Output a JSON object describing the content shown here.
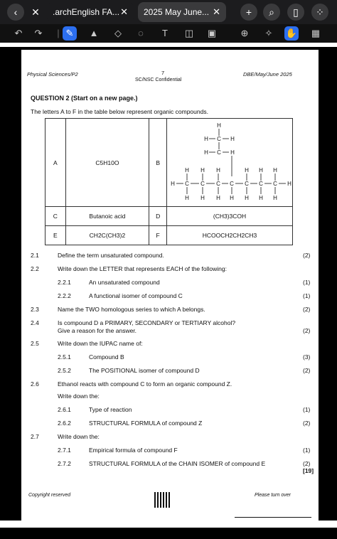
{
  "tabs": [
    {
      "label": ".archEnglish FA..."
    },
    {
      "label": "2025 May June..."
    }
  ],
  "toolbar_icons": [
    "undo-icon",
    "redo-icon",
    "pen-icon",
    "highlighter-icon",
    "eraser-icon",
    "lasso-icon",
    "text-icon",
    "shapes-icon",
    "image-icon",
    "zoom-icon",
    "laser-icon",
    "hand-icon",
    "grid-icon"
  ],
  "header": {
    "left": "Physical Sciences/P2",
    "page_num": "7",
    "center": "SC/NSC Confidential",
    "right": "DBE/May/June 2025"
  },
  "question": {
    "title": "QUESTION 2 (Start on a new page.)",
    "intro": "The letters A to F in the table below represent organic compounds."
  },
  "table": {
    "a_letter": "A",
    "a_formula": "C5H10O",
    "b_letter": "B",
    "c_letter": "C",
    "c_name": "Butanoic acid",
    "d_letter": "D",
    "d_formula": "(CH3)3COH",
    "e_letter": "E",
    "e_formula": "CH2C(CH3)2",
    "f_letter": "F",
    "f_formula": "HCOOCH2CH2CH3"
  },
  "items": [
    {
      "num": "2.1",
      "text": "Define the term unsaturated compound.",
      "mark": "(2)"
    },
    {
      "num": "2.2",
      "text": "Write down the LETTER that represents EACH of the following:",
      "mark": ""
    },
    {
      "num": "2.2.1",
      "text": "An unsaturated compound",
      "mark": "(1)"
    },
    {
      "num": "2.2.2",
      "text": "A functional isomer of compound C",
      "mark": "(1)"
    },
    {
      "num": "2.3",
      "text": "Name the TWO homologous series to which A belongs.",
      "mark": "(2)"
    },
    {
      "num": "2.4",
      "text": "Is compound D a PRIMARY, SECONDARY or TERTIARY alcohol?",
      "mark": ""
    },
    {
      "num": "",
      "text": "Give a reason for the answer.",
      "mark": "(2)"
    },
    {
      "num": "2.5",
      "text": "Write down the IUPAC name of:",
      "mark": ""
    },
    {
      "num": "2.5.1",
      "text": "Compound B",
      "mark": "(3)"
    },
    {
      "num": "2.5.2",
      "text": "The POSITIONAL isomer of compound D",
      "mark": "(2)"
    },
    {
      "num": "2.6",
      "text": "Ethanol reacts with compound C to form an organic compound Z.",
      "mark": ""
    },
    {
      "num": "",
      "text": "Write down the:",
      "mark": ""
    },
    {
      "num": "2.6.1",
      "text": "Type of reaction",
      "mark": "(1)"
    },
    {
      "num": "2.6.2",
      "text": "STRUCTURAL FORMULA of compound Z",
      "mark": "(2)"
    },
    {
      "num": "2.7",
      "text": "Write down the:",
      "mark": ""
    },
    {
      "num": "2.7.1",
      "text": "Empirical formula of compound F",
      "mark": "(1)"
    },
    {
      "num": "2.7.2",
      "text": "STRUCTURAL FORMULA of the CHAIN ISOMER of compound E",
      "mark": "(2)"
    }
  ],
  "total": "[19]",
  "footer": {
    "left": "Copyright reserved",
    "right": "Please turn over"
  }
}
